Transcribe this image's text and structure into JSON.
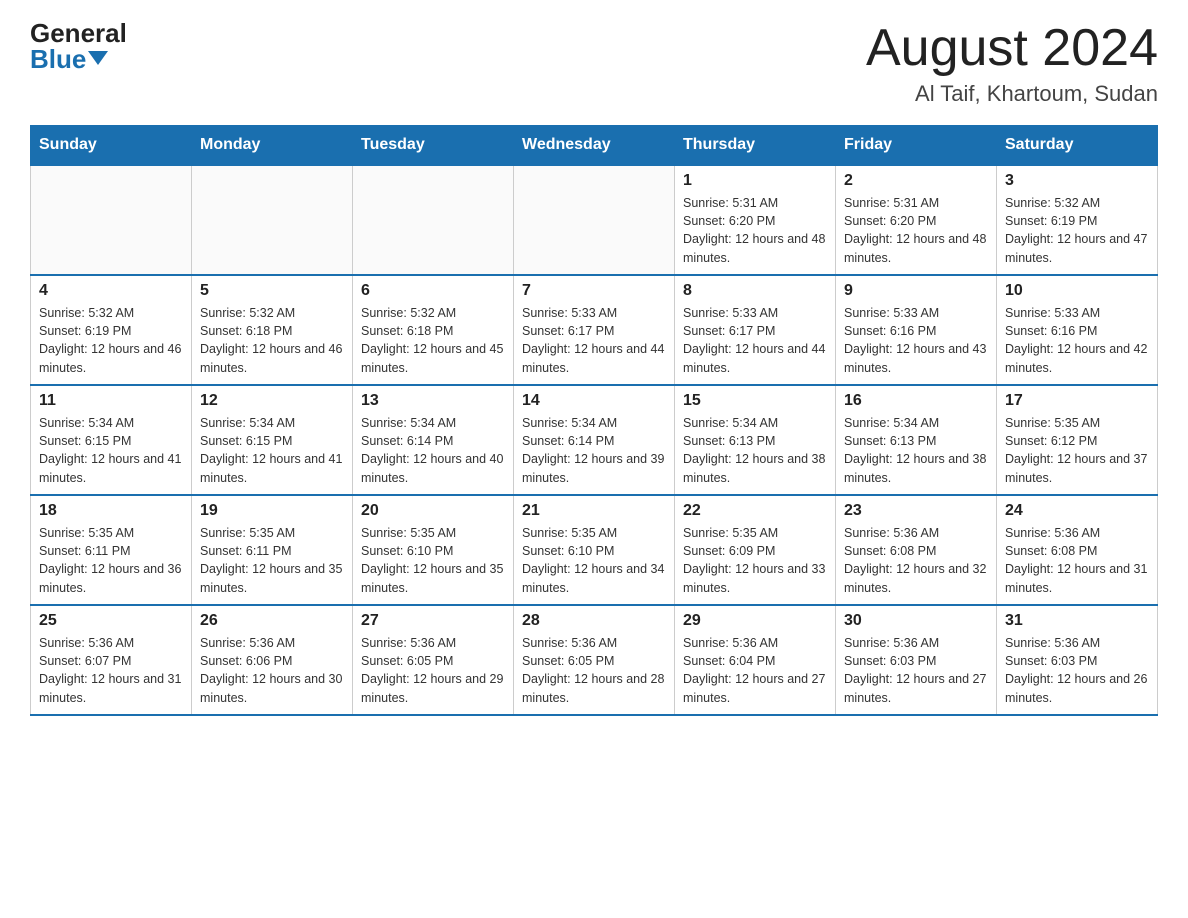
{
  "header": {
    "logo_general": "General",
    "logo_blue": "Blue",
    "month_title": "August 2024",
    "location": "Al Taif, Khartoum, Sudan"
  },
  "days_of_week": [
    "Sunday",
    "Monday",
    "Tuesday",
    "Wednesday",
    "Thursday",
    "Friday",
    "Saturday"
  ],
  "weeks": [
    [
      {
        "day": "",
        "info": ""
      },
      {
        "day": "",
        "info": ""
      },
      {
        "day": "",
        "info": ""
      },
      {
        "day": "",
        "info": ""
      },
      {
        "day": "1",
        "info": "Sunrise: 5:31 AM\nSunset: 6:20 PM\nDaylight: 12 hours and 48 minutes."
      },
      {
        "day": "2",
        "info": "Sunrise: 5:31 AM\nSunset: 6:20 PM\nDaylight: 12 hours and 48 minutes."
      },
      {
        "day": "3",
        "info": "Sunrise: 5:32 AM\nSunset: 6:19 PM\nDaylight: 12 hours and 47 minutes."
      }
    ],
    [
      {
        "day": "4",
        "info": "Sunrise: 5:32 AM\nSunset: 6:19 PM\nDaylight: 12 hours and 46 minutes."
      },
      {
        "day": "5",
        "info": "Sunrise: 5:32 AM\nSunset: 6:18 PM\nDaylight: 12 hours and 46 minutes."
      },
      {
        "day": "6",
        "info": "Sunrise: 5:32 AM\nSunset: 6:18 PM\nDaylight: 12 hours and 45 minutes."
      },
      {
        "day": "7",
        "info": "Sunrise: 5:33 AM\nSunset: 6:17 PM\nDaylight: 12 hours and 44 minutes."
      },
      {
        "day": "8",
        "info": "Sunrise: 5:33 AM\nSunset: 6:17 PM\nDaylight: 12 hours and 44 minutes."
      },
      {
        "day": "9",
        "info": "Sunrise: 5:33 AM\nSunset: 6:16 PM\nDaylight: 12 hours and 43 minutes."
      },
      {
        "day": "10",
        "info": "Sunrise: 5:33 AM\nSunset: 6:16 PM\nDaylight: 12 hours and 42 minutes."
      }
    ],
    [
      {
        "day": "11",
        "info": "Sunrise: 5:34 AM\nSunset: 6:15 PM\nDaylight: 12 hours and 41 minutes."
      },
      {
        "day": "12",
        "info": "Sunrise: 5:34 AM\nSunset: 6:15 PM\nDaylight: 12 hours and 41 minutes."
      },
      {
        "day": "13",
        "info": "Sunrise: 5:34 AM\nSunset: 6:14 PM\nDaylight: 12 hours and 40 minutes."
      },
      {
        "day": "14",
        "info": "Sunrise: 5:34 AM\nSunset: 6:14 PM\nDaylight: 12 hours and 39 minutes."
      },
      {
        "day": "15",
        "info": "Sunrise: 5:34 AM\nSunset: 6:13 PM\nDaylight: 12 hours and 38 minutes."
      },
      {
        "day": "16",
        "info": "Sunrise: 5:34 AM\nSunset: 6:13 PM\nDaylight: 12 hours and 38 minutes."
      },
      {
        "day": "17",
        "info": "Sunrise: 5:35 AM\nSunset: 6:12 PM\nDaylight: 12 hours and 37 minutes."
      }
    ],
    [
      {
        "day": "18",
        "info": "Sunrise: 5:35 AM\nSunset: 6:11 PM\nDaylight: 12 hours and 36 minutes."
      },
      {
        "day": "19",
        "info": "Sunrise: 5:35 AM\nSunset: 6:11 PM\nDaylight: 12 hours and 35 minutes."
      },
      {
        "day": "20",
        "info": "Sunrise: 5:35 AM\nSunset: 6:10 PM\nDaylight: 12 hours and 35 minutes."
      },
      {
        "day": "21",
        "info": "Sunrise: 5:35 AM\nSunset: 6:10 PM\nDaylight: 12 hours and 34 minutes."
      },
      {
        "day": "22",
        "info": "Sunrise: 5:35 AM\nSunset: 6:09 PM\nDaylight: 12 hours and 33 minutes."
      },
      {
        "day": "23",
        "info": "Sunrise: 5:36 AM\nSunset: 6:08 PM\nDaylight: 12 hours and 32 minutes."
      },
      {
        "day": "24",
        "info": "Sunrise: 5:36 AM\nSunset: 6:08 PM\nDaylight: 12 hours and 31 minutes."
      }
    ],
    [
      {
        "day": "25",
        "info": "Sunrise: 5:36 AM\nSunset: 6:07 PM\nDaylight: 12 hours and 31 minutes."
      },
      {
        "day": "26",
        "info": "Sunrise: 5:36 AM\nSunset: 6:06 PM\nDaylight: 12 hours and 30 minutes."
      },
      {
        "day": "27",
        "info": "Sunrise: 5:36 AM\nSunset: 6:05 PM\nDaylight: 12 hours and 29 minutes."
      },
      {
        "day": "28",
        "info": "Sunrise: 5:36 AM\nSunset: 6:05 PM\nDaylight: 12 hours and 28 minutes."
      },
      {
        "day": "29",
        "info": "Sunrise: 5:36 AM\nSunset: 6:04 PM\nDaylight: 12 hours and 27 minutes."
      },
      {
        "day": "30",
        "info": "Sunrise: 5:36 AM\nSunset: 6:03 PM\nDaylight: 12 hours and 27 minutes."
      },
      {
        "day": "31",
        "info": "Sunrise: 5:36 AM\nSunset: 6:03 PM\nDaylight: 12 hours and 26 minutes."
      }
    ]
  ]
}
